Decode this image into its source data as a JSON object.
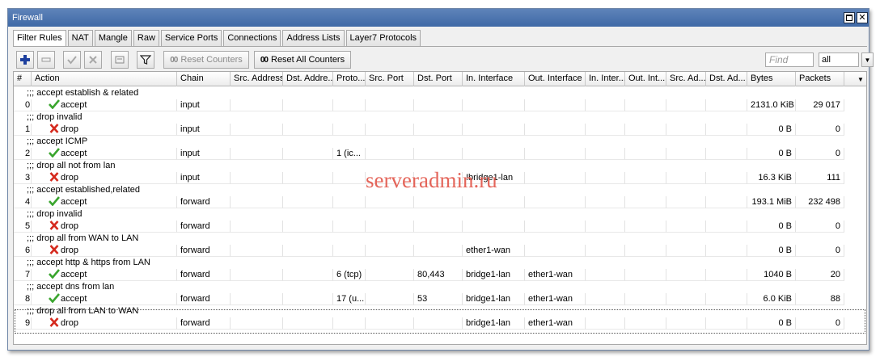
{
  "window": {
    "title": "Firewall"
  },
  "tabs": [
    {
      "label": "Filter Rules",
      "active": true
    },
    {
      "label": "NAT"
    },
    {
      "label": "Mangle"
    },
    {
      "label": "Raw"
    },
    {
      "label": "Service Ports"
    },
    {
      "label": "Connections"
    },
    {
      "label": "Address Lists"
    },
    {
      "label": "Layer7 Protocols"
    }
  ],
  "toolbar": {
    "reset_counters_icon": "00",
    "reset_counters": "Reset Counters",
    "reset_all_icon": "00",
    "reset_all_counters": "Reset All Counters",
    "find_placeholder": "Find",
    "scope_value": "all"
  },
  "columns": [
    "#",
    "Action",
    "Chain",
    "Src. Address",
    "Dst. Addre...",
    "Proto...",
    "Src. Port",
    "Dst. Port",
    "In. Interface",
    "Out. Interface",
    "In. Inter...",
    "Out. Int...",
    "Src. Ad...",
    "Dst. Ad...",
    "Bytes",
    "Packets"
  ],
  "rules": [
    {
      "comment": ";;; accept establish & related",
      "num": "0",
      "action": "accept",
      "chain": "input",
      "proto": "",
      "dst_port": "",
      "in_if": "",
      "out_if": "",
      "bytes": "2131.0 KiB",
      "packets": "29 017"
    },
    {
      "comment": ";;; drop invalid",
      "num": "1",
      "action": "drop",
      "chain": "input",
      "proto": "",
      "dst_port": "",
      "in_if": "",
      "out_if": "",
      "bytes": "0 B",
      "packets": "0"
    },
    {
      "comment": ";;; accept ICMP",
      "num": "2",
      "action": "accept",
      "chain": "input",
      "proto": "1 (ic...",
      "dst_port": "",
      "in_if": "",
      "out_if": "",
      "bytes": "0 B",
      "packets": "0"
    },
    {
      "comment": ";;; drop all not from lan",
      "num": "3",
      "action": "drop",
      "chain": "input",
      "proto": "",
      "dst_port": "",
      "in_if": "!bridge1-lan",
      "out_if": "",
      "bytes": "16.3 KiB",
      "packets": "111"
    },
    {
      "comment": ";;; accept established,related",
      "num": "4",
      "action": "accept",
      "chain": "forward",
      "proto": "",
      "dst_port": "",
      "in_if": "",
      "out_if": "",
      "bytes": "193.1 MiB",
      "packets": "232 498"
    },
    {
      "comment": ";;; drop invalid",
      "num": "5",
      "action": "drop",
      "chain": "forward",
      "proto": "",
      "dst_port": "",
      "in_if": "",
      "out_if": "",
      "bytes": "0 B",
      "packets": "0"
    },
    {
      "comment": ";;; drop all from WAN to LAN",
      "num": "6",
      "action": "drop",
      "chain": "forward",
      "proto": "",
      "dst_port": "",
      "in_if": "ether1-wan",
      "out_if": "",
      "bytes": "0 B",
      "packets": "0"
    },
    {
      "comment": ";;; accept http & https from LAN",
      "num": "7",
      "action": "accept",
      "chain": "forward",
      "proto": "6 (tcp)",
      "dst_port": "80,443",
      "in_if": "bridge1-lan",
      "out_if": "ether1-wan",
      "bytes": "1040 B",
      "packets": "20"
    },
    {
      "comment": ";;; accept dns from lan",
      "num": "8",
      "action": "accept",
      "chain": "forward",
      "proto": "17 (u...",
      "dst_port": "53",
      "in_if": "bridge1-lan",
      "out_if": "ether1-wan",
      "bytes": "6.0 KiB",
      "packets": "88"
    },
    {
      "comment": ";;; drop all from LAN to WAN",
      "num": "9",
      "action": "drop",
      "chain": "forward",
      "proto": "",
      "dst_port": "",
      "in_if": "bridge1-lan",
      "out_if": "ether1-wan",
      "bytes": "0 B",
      "packets": "0"
    }
  ],
  "watermark": "serveradmin.ru",
  "colors": {
    "accept": "#3aa52e",
    "drop": "#d52a1e",
    "titlebar": "#4a72ad"
  }
}
